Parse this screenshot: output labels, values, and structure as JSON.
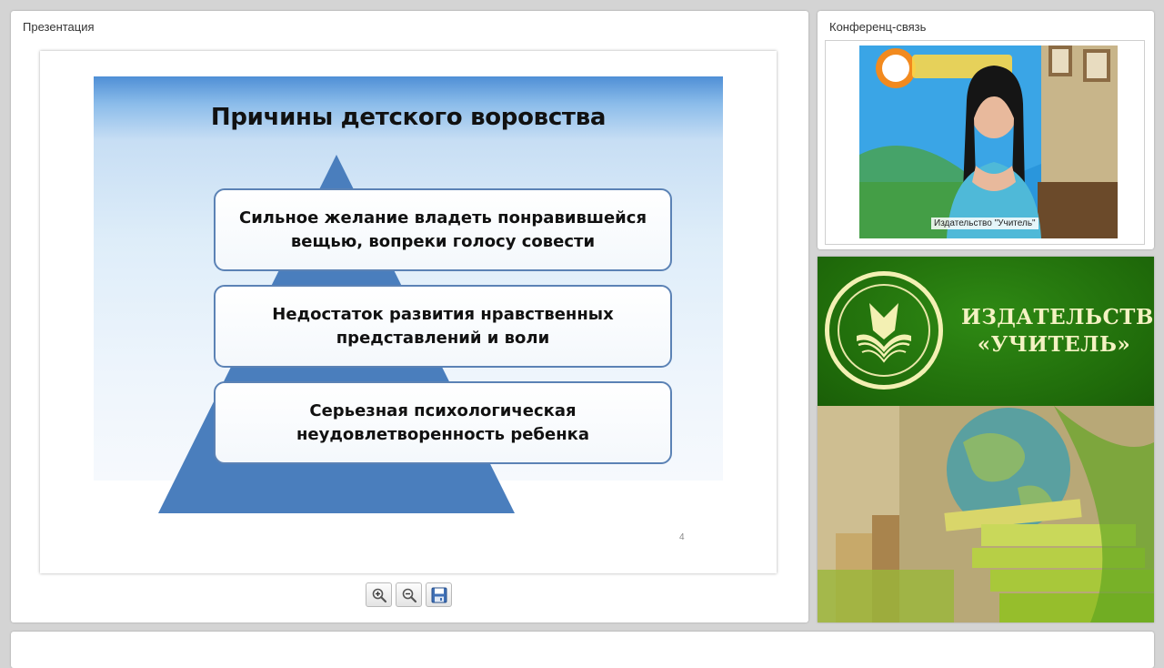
{
  "presentation": {
    "panel_title": "Презентация",
    "slide": {
      "title": "Причины детского воровства",
      "boxes": [
        {
          "line1": "Сильное желание владеть понравившейся",
          "line2": "вещью, вопреки голосу совести"
        },
        {
          "line1": "Недостаток развития нравственных",
          "line2": "представлений и воли"
        },
        {
          "line1": "Серьезная психологическая",
          "line2": "неудовлетворенность ребенка"
        }
      ],
      "page_number": "4"
    },
    "toolbar": {
      "zoom_in_icon": "zoom-in-icon",
      "zoom_out_icon": "zoom-out-icon",
      "save_icon": "floppy-disk-icon"
    }
  },
  "conference": {
    "panel_title": "Конференц-связь",
    "video_label": "Издательство \"Учитель\""
  },
  "banner": {
    "line1": "ИЗДАТЕЛЬСТВО",
    "line2": "«УЧИТЕЛЬ»"
  },
  "colors": {
    "pyramid": "#4a7ebd",
    "box_border": "#5b82b5",
    "banner_green": "#2e7d10",
    "banner_text": "#f4f2c2"
  }
}
